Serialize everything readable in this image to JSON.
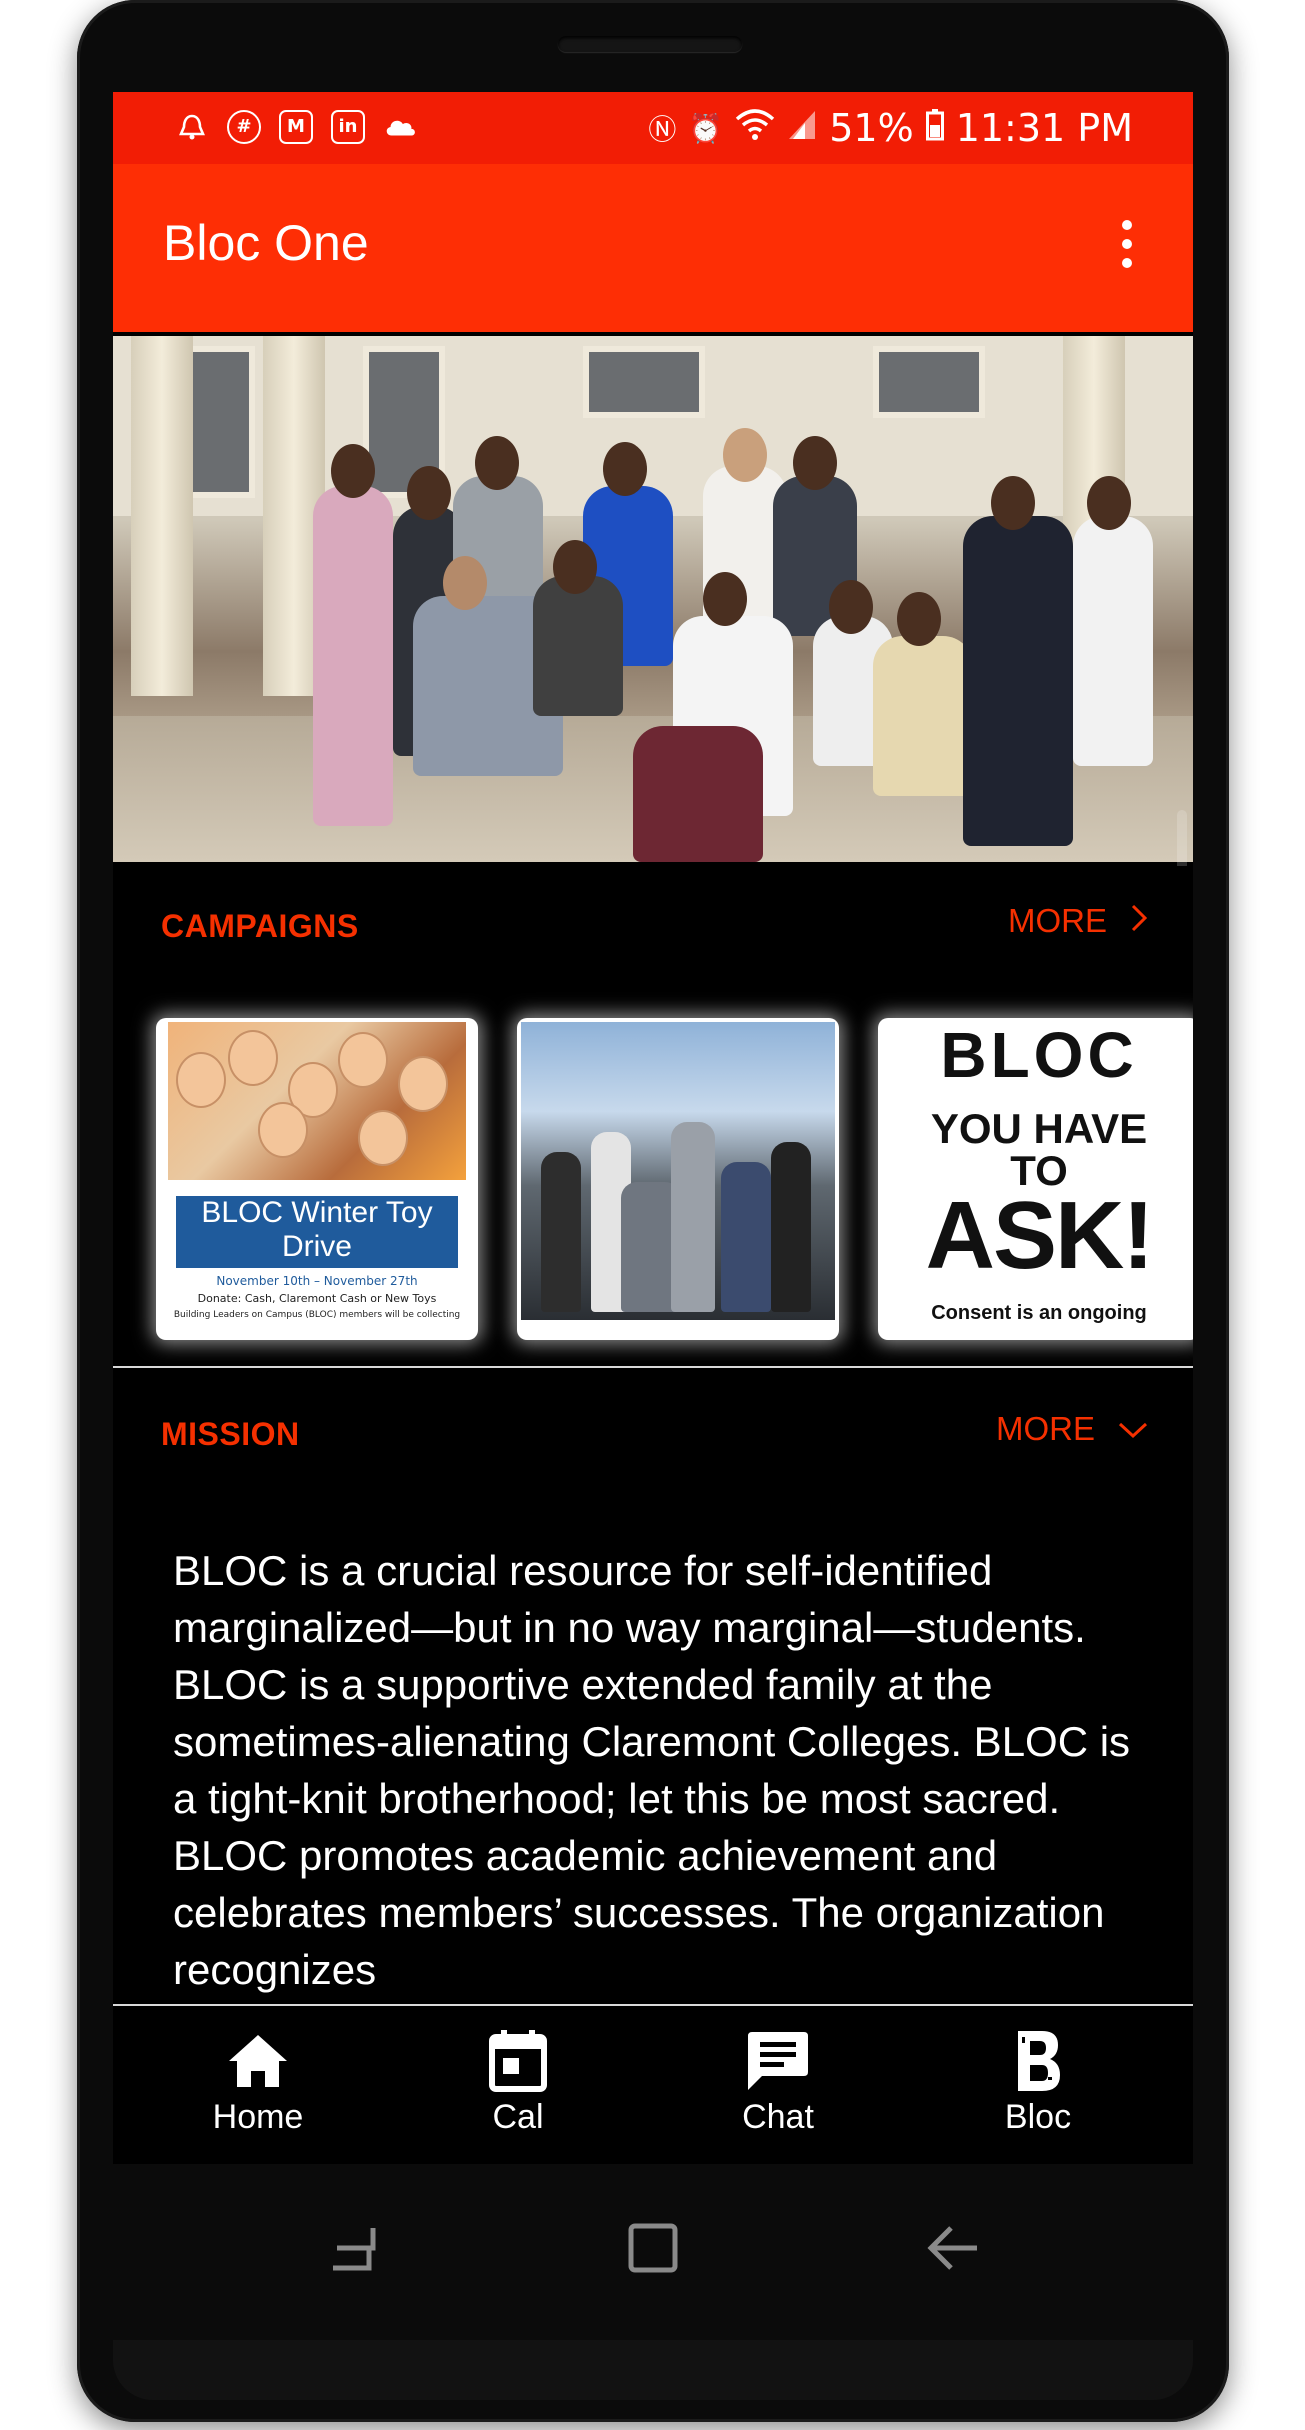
{
  "status_bar": {
    "left_icons": [
      "alarm-icon",
      "slack-icon",
      "gmail-icon",
      "linkedin-icon",
      "cloud-icon"
    ],
    "right_icons": [
      "nfc-icon",
      "alarm-clock-icon",
      "wifi-icon",
      "signal-icon"
    ],
    "battery": "51%",
    "time": "11:31 PM"
  },
  "app_bar": {
    "title": "Bloc One",
    "menu_icon": "overflow-menu-icon"
  },
  "campaigns": {
    "title": "CAMPAIGNS",
    "more_label": "MORE",
    "cards": [
      {
        "banner": "BLOC Winter Toy Drive",
        "dates": "November 10th – November 27th",
        "donate": "Donate: Cash, Claremont Cash or New Toys",
        "fine_print": "Building Leaders on Campus (BLOC) members will be collecting"
      },
      {},
      {
        "logo": "BLOC",
        "line1": "YOU HAVE",
        "line2": "TO",
        "big": "ASK!",
        "footer": "Consent is an ongoing"
      }
    ]
  },
  "mission": {
    "title": "MISSION",
    "more_label": "MORE",
    "text": "BLOC is a crucial resource for self-identified marginalized—but in no way marginal—students. BLOC is a supportive extended family at the sometimes-alienating Claremont Colleges. BLOC is a tight-knit brotherhood; let this be most sacred. BLOC promotes academic achievement and celebrates members’ successes. The organization recognizes"
  },
  "bottom_nav": [
    {
      "label": "Home",
      "icon": "home-icon"
    },
    {
      "label": "Cal",
      "icon": "calendar-icon"
    },
    {
      "label": "Chat",
      "icon": "chat-icon"
    },
    {
      "label": "Bloc",
      "icon": "bloc-icon"
    }
  ],
  "system_nav": [
    "recents-icon",
    "home-square-icon",
    "back-icon"
  ],
  "colors": {
    "status_bar": "#f21d05",
    "app_bar": "#fe2e05",
    "accent": "#f53000",
    "background": "#000000",
    "text": "#ffffff"
  }
}
